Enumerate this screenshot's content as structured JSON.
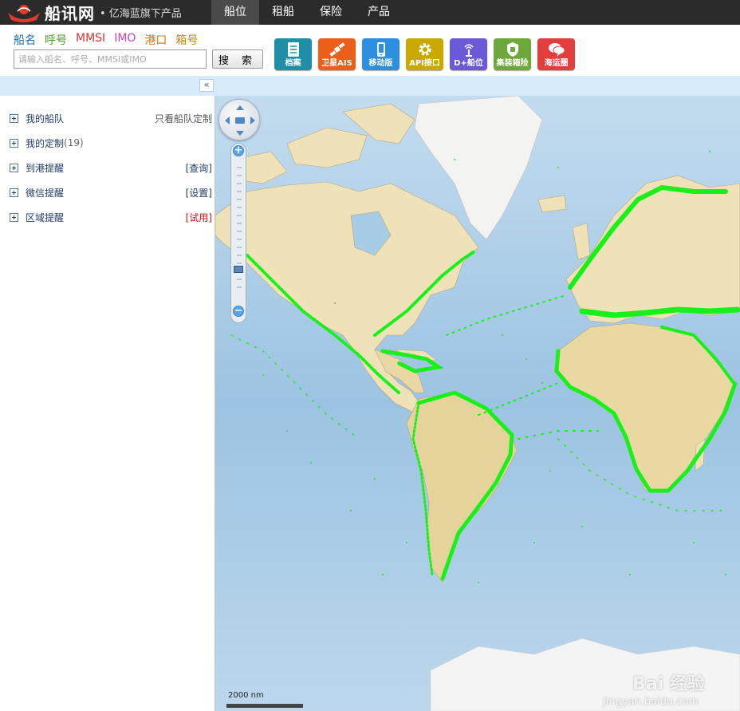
{
  "brand": {
    "name": "船讯网",
    "tagline": "• 亿海蓝旗下产品"
  },
  "nav": {
    "items": [
      "船位",
      "租船",
      "保险",
      "产品"
    ],
    "active_index": 0
  },
  "search": {
    "tabs": [
      {
        "label": "船名",
        "color": "#1a6bb8"
      },
      {
        "label": "呼号",
        "color": "#4a9a1a"
      },
      {
        "label": "MMSI",
        "color": "#e03030"
      },
      {
        "label": "IMO",
        "color": "#d040c8"
      },
      {
        "label": "港口",
        "color": "#d07810"
      },
      {
        "label": "箱号",
        "color": "#b88a10"
      }
    ],
    "placeholder": "请输入船名、呼号、MMSI或IMO",
    "button_label": "搜 索"
  },
  "tools": [
    {
      "label": "档案",
      "color": "#1f8fa8",
      "icon": "document-icon"
    },
    {
      "label": "卫星AIS",
      "color": "#ec5f1b",
      "icon": "satellite-icon"
    },
    {
      "label": "移动版",
      "color": "#2d8fe0",
      "icon": "phone-icon"
    },
    {
      "label": "API接口",
      "color": "#c9a800",
      "icon": "gear-icon"
    },
    {
      "label": "D+船位",
      "color": "#6a5ad8",
      "icon": "antenna-icon"
    },
    {
      "label": "集装箱险",
      "color": "#6ea83a",
      "icon": "shield-icon"
    },
    {
      "label": "海运圈",
      "color": "#e33e3e",
      "icon": "chat-icon"
    }
  ],
  "sidebar": {
    "items": [
      {
        "label": "我的船队",
        "count": "",
        "link": "只看船队定制",
        "link_style": "gray"
      },
      {
        "label": "我的定制",
        "count": "(19)",
        "link": "",
        "link_style": ""
      },
      {
        "label": "到港提醒",
        "count": "",
        "link": "[查询]",
        "link_style": "blue"
      },
      {
        "label": "微信提醒",
        "count": "",
        "link": "[设置]",
        "link_style": "blue"
      },
      {
        "label": "区域提醒",
        "count": "",
        "link": "[试用]",
        "link_style": "red"
      }
    ]
  },
  "map": {
    "scale_label": "2000 nm",
    "watermark": "Bai 经验",
    "watermark_url": "jingyan.baidu.com",
    "colors": {
      "ocean": "#a9cce6",
      "land": "#efe2b8",
      "ice": "#f4f4f4",
      "ship": "#18f018"
    },
    "zoom_level_fraction": 0.22
  }
}
